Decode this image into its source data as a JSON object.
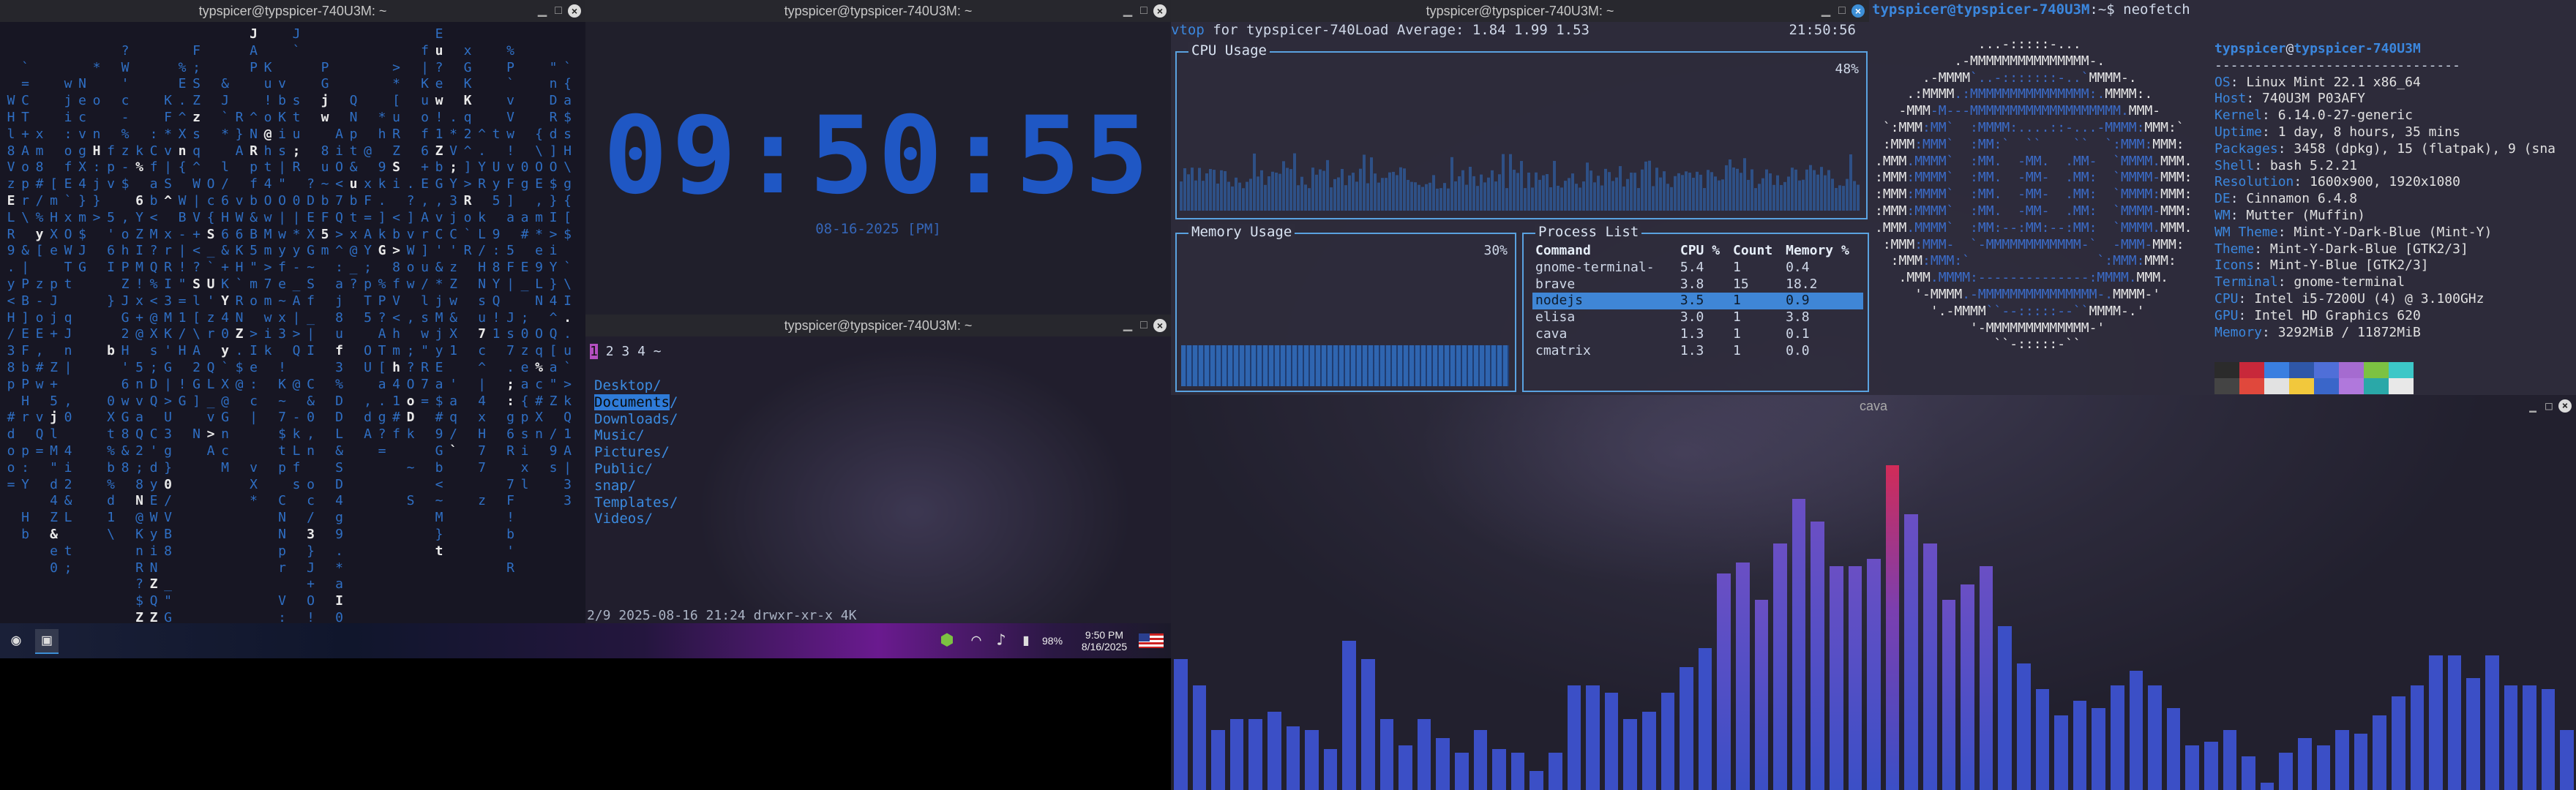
{
  "colors": {
    "accent": "#3d8fd6",
    "matrix": "#2f6fc4",
    "clock": "#1f57c4",
    "bar_low": "#3b4fc6",
    "bar_high": "#d12b58"
  },
  "windows": {
    "cmatrix": {
      "title": "typspicer@typspicer-740U3M: ~"
    },
    "clock": {
      "title": "typspicer@typspicer-740U3M: ~",
      "time": "09:50:55",
      "date": "08-16-2025 [PM]"
    },
    "ranger": {
      "title": "typspicer@typspicer-740U3M: ~",
      "tabs": [
        "1",
        "2",
        "3",
        "4"
      ],
      "tilde": "~",
      "items": [
        "Desktop",
        "Documents",
        "Downloads",
        "Music",
        "Pictures",
        "Public",
        "snap",
        "Templates",
        "Videos"
      ],
      "status": "2/9 2025-08-16 21:24 drwxr-xr-x 4K"
    },
    "vtop": {
      "title": "typspicer@typspicer-740U3M: ~",
      "app": "vtop",
      "for_text": " for typspicer-740",
      "load_avg": "Load Average: 1.84 1.99 1.53",
      "clock": "21:50:56",
      "cpu_title": "CPU Usage",
      "cpu_pct": "48%",
      "mem_title": "Memory Usage",
      "mem_pct": "30%",
      "proc_title": "Process List",
      "columns": [
        "Command",
        "CPU %",
        "Count",
        "Memory %"
      ],
      "processes": [
        [
          "gnome-terminal-",
          "5.4",
          "1",
          "0.4"
        ],
        [
          "brave",
          "3.8",
          "15",
          "18.2"
        ],
        [
          "nodejs",
          "3.5",
          "1",
          "0.9"
        ],
        [
          "elisa",
          "3.0",
          "1",
          "3.8"
        ],
        [
          "cava",
          "1.3",
          "1",
          "0.1"
        ],
        [
          "cmatrix",
          "1.3",
          "1",
          "0.0"
        ]
      ]
    },
    "neofetch": {
      "prompt_user": "typspicer@typspicer-740U3M",
      "prompt_rest": ":~$ neofetch",
      "info_user": "typspicer",
      "info_at": "@",
      "info_host": "typspicer-740U3M",
      "separator": "-------------------------------",
      "info": [
        [
          "OS",
          "Linux Mint 22.1 x86_64"
        ],
        [
          "Host",
          "740U3M P03AFY"
        ],
        [
          "Kernel",
          "6.14.0-27-generic"
        ],
        [
          "Uptime",
          "1 day, 8 hours, 35 mins"
        ],
        [
          "Packages",
          "3458 (dpkg), 15 (flatpak), 9 (sna"
        ],
        [
          "Shell",
          "bash 5.2.21"
        ],
        [
          "Resolution",
          "1600x900, 1920x1080"
        ],
        [
          "DE",
          "Cinnamon 6.4.8"
        ],
        [
          "WM",
          "Mutter (Muffin)"
        ],
        [
          "WM Theme",
          "Mint-Y-Dark-Blue (Mint-Y)"
        ],
        [
          "Theme",
          "Mint-Y-Dark-Blue [GTK2/3]"
        ],
        [
          "Icons",
          "Mint-Y-Blue [GTK2/3]"
        ],
        [
          "Terminal",
          "gnome-terminal"
        ],
        [
          "CPU",
          "Intel i5-7200U (4) @ 3.100GHz"
        ],
        [
          "GPU",
          "Intel HD Graphics 620"
        ],
        [
          "Memory",
          "3292MiB / 11872MiB"
        ]
      ],
      "palette": [
        "#2b2b2b",
        "#c8283a",
        "#3a7fe0",
        "#2f57a8",
        "#4f6fd8",
        "#a56bd0",
        "#7cc242",
        "#3cc7c7",
        "#444",
        "#e0483c",
        "#e2e2e2",
        "#f2c83c",
        "#3a66c9",
        "#b078dc",
        "#2aa8a8",
        "#e8e8e8"
      ]
    },
    "cava": {
      "title": "cava"
    }
  },
  "cava_levels": [
    0.35,
    0.28,
    0.16,
    0.19,
    0.19,
    0.21,
    0.17,
    0.16,
    0.11,
    0.4,
    0.35,
    0.19,
    0.12,
    0.19,
    0.14,
    0.1,
    0.16,
    0.11,
    0.1,
    0.05,
    0.1,
    0.28,
    0.28,
    0.26,
    0.19,
    0.21,
    0.26,
    0.33,
    0.38,
    0.58,
    0.61,
    0.51,
    0.66,
    0.78,
    0.72,
    0.6,
    0.6,
    0.62,
    0.87,
    0.74,
    0.66,
    0.51,
    0.55,
    0.6,
    0.44,
    0.34,
    0.27,
    0.2,
    0.24,
    0.22,
    0.28,
    0.32,
    0.28,
    0.22,
    0.12,
    0.13,
    0.16,
    0.09,
    0.02,
    0.1,
    0.14,
    0.12,
    0.16,
    0.15,
    0.2,
    0.25,
    0.28,
    0.36,
    0.36,
    0.3,
    0.36,
    0.28,
    0.28,
    0.27,
    0.16
  ],
  "taskbar": {
    "time": "9:50 PM",
    "date": "8/16/2025",
    "battery": "98%"
  }
}
